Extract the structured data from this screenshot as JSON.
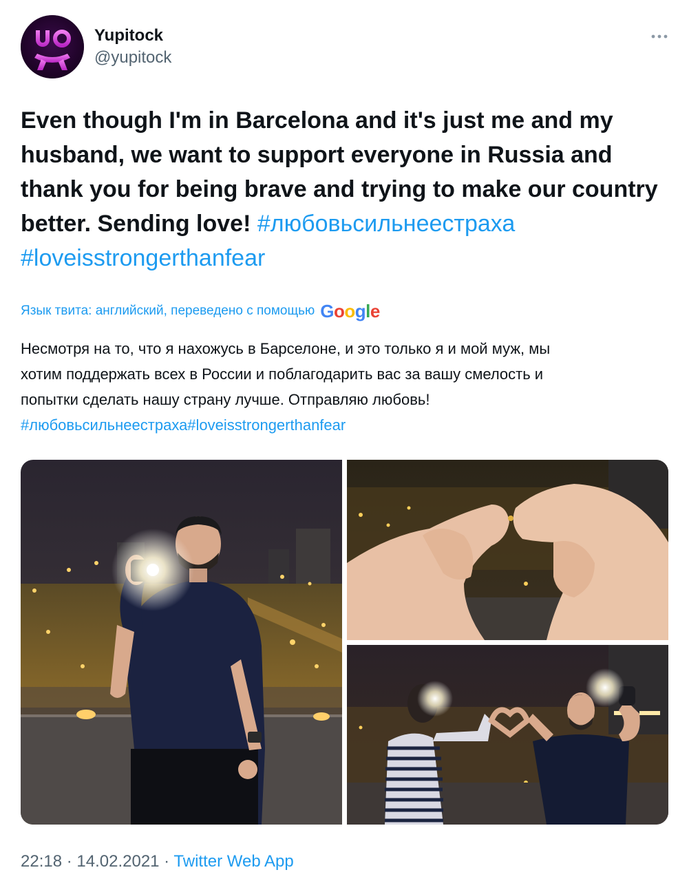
{
  "author": {
    "display_name": "Yupitock",
    "handle": "@yupitock",
    "avatar_text": "UO"
  },
  "tweet": {
    "lines": [
      "Even though I'm in Barcelona and it's just me and my",
      "husband, we want to support everyone in Russia and",
      "thank you for being brave and trying to make our country",
      "better. Sending love! "
    ],
    "hashtag_1": "#любовьсильнеестраха",
    "hashtag_2": "#loveisstrongerthanfear"
  },
  "translation": {
    "note": "Язык твита: английский, переведено с помощью",
    "provider": "Google",
    "lines": [
      "Несмотря на то, что я нахожусь в Барселоне, и это только я и мой муж, мы",
      "хотим поддержать всех в России и поблагодарить вас за вашу смелость и",
      "попытки сделать нашу страну лучше. Отправляю любовь!"
    ],
    "hashtags": "#любовьсильнеестраха#loveisstrongerthanfear"
  },
  "footer": {
    "time": "22:18",
    "separator": " · ",
    "date": "14.02.2021",
    "source": "Twitter Web App"
  },
  "colors": {
    "link": "#1d9bf0",
    "secondary_text": "#536471",
    "avatar_bg": "#23032e",
    "avatar_accent": "#d63bd6"
  },
  "icons": {
    "more": "more-horizontal-icon",
    "logo": "yupitock-logo-icon"
  }
}
